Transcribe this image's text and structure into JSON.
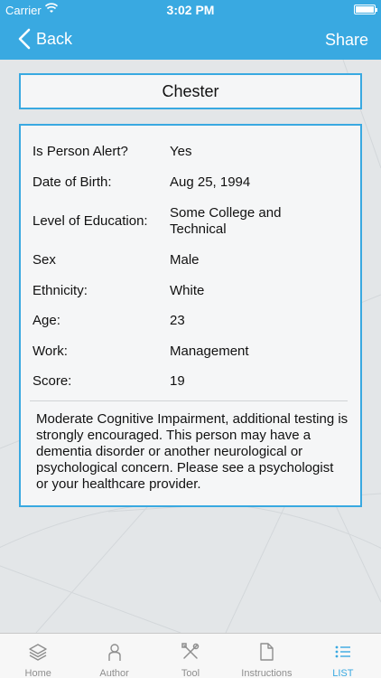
{
  "status_bar": {
    "carrier": "Carrier",
    "time": "3:02 PM"
  },
  "nav": {
    "back_label": "Back",
    "share_label": "Share"
  },
  "person": {
    "name": "Chester",
    "fields": [
      {
        "label": "Is Person Alert?",
        "value": "Yes"
      },
      {
        "label": "Date of Birth:",
        "value": "Aug 25, 1994"
      },
      {
        "label": "Level of Education:",
        "value": "Some College and Technical"
      },
      {
        "label": "Sex",
        "value": "Male"
      },
      {
        "label": "Ethnicity:",
        "value": "White"
      },
      {
        "label": "Age:",
        "value": "23"
      },
      {
        "label": "Work:",
        "value": "Management"
      },
      {
        "label": "Score:",
        "value": "19"
      }
    ],
    "result": "Moderate Cognitive Impairment, additional testing is strongly encouraged.  This person may have a dementia disorder or another neurological or psychological concern. Please see a psychologist or your healthcare provider."
  },
  "tabs": [
    {
      "label": "Home",
      "icon": "layers-icon"
    },
    {
      "label": "Author",
      "icon": "person-icon"
    },
    {
      "label": "Tool",
      "icon": "tools-icon"
    },
    {
      "label": "Instructions",
      "icon": "document-icon"
    },
    {
      "label": "LIST",
      "icon": "list-icon",
      "active": true
    }
  ],
  "colors": {
    "accent": "#39a9e1",
    "background": "#e3e6e8",
    "card": "#f5f6f7"
  }
}
